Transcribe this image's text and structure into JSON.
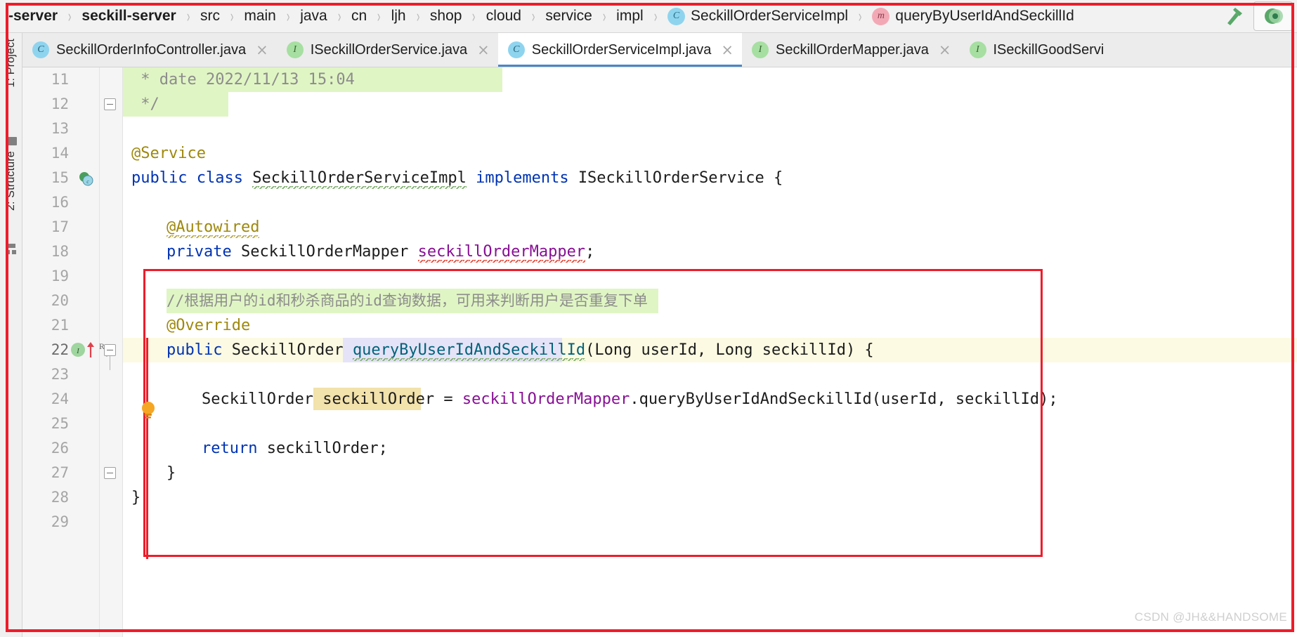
{
  "breadcrumb": {
    "items": [
      {
        "label": "-server",
        "bold": true,
        "icon": null
      },
      {
        "label": "seckill-server",
        "bold": true,
        "icon": null
      },
      {
        "label": "src",
        "bold": false,
        "icon": null
      },
      {
        "label": "main",
        "bold": false,
        "icon": null
      },
      {
        "label": "java",
        "bold": false,
        "icon": null
      },
      {
        "label": "cn",
        "bold": false,
        "icon": null
      },
      {
        "label": "ljh",
        "bold": false,
        "icon": null
      },
      {
        "label": "shop",
        "bold": false,
        "icon": null
      },
      {
        "label": "cloud",
        "bold": false,
        "icon": null
      },
      {
        "label": "service",
        "bold": false,
        "icon": null
      },
      {
        "label": "impl",
        "bold": false,
        "icon": null
      },
      {
        "label": "SeckillOrderServiceImpl",
        "bold": false,
        "icon": "class-icon",
        "icon_letter": "C"
      },
      {
        "label": "queryByUserIdAndSeckillId",
        "bold": false,
        "icon": "method-icon",
        "icon_letter": "m"
      }
    ],
    "separator": "›",
    "actions": {
      "build_label": "build-hammer-icon",
      "run_label": "run-icon"
    }
  },
  "tabs": [
    {
      "label": "SeckillOrderInfoController.java",
      "icon": "class-icon",
      "icon_letter": "C",
      "kind": "class",
      "active": false,
      "close": "×"
    },
    {
      "label": "ISeckillOrderService.java",
      "icon": "interface-icon",
      "icon_letter": "I",
      "kind": "interface",
      "active": false,
      "close": "×"
    },
    {
      "label": "SeckillOrderServiceImpl.java",
      "icon": "class-icon",
      "icon_letter": "C",
      "kind": "class",
      "active": true,
      "close": "×"
    },
    {
      "label": "SeckillOrderMapper.java",
      "icon": "interface-icon",
      "icon_letter": "I",
      "kind": "interface",
      "active": false,
      "close": "×"
    },
    {
      "label": "ISeckillGoodServi",
      "icon": "interface-icon",
      "icon_letter": "I",
      "kind": "interface",
      "active": false,
      "close": ""
    }
  ],
  "tool_strip": {
    "project_label": "1: Project",
    "structure_label": "2: Structure"
  },
  "editor": {
    "first_line": 11,
    "lines": [
      {
        "n": 11,
        "text": " * date 2022/11/13 15:04"
      },
      {
        "n": 12,
        "text": " */"
      },
      {
        "n": 13,
        "text": ""
      },
      {
        "n": 14,
        "text": "@Service"
      },
      {
        "n": 15,
        "text": "public class SeckillOrderServiceImpl implements ISeckillOrderService {"
      },
      {
        "n": 16,
        "text": ""
      },
      {
        "n": 17,
        "text": "    @Autowired"
      },
      {
        "n": 18,
        "text": "    private SeckillOrderMapper seckillOrderMapper;"
      },
      {
        "n": 19,
        "text": ""
      },
      {
        "n": 20,
        "text": "    //根据用户的id和秒杀商品的id查询数据，可用来判断用户是否重复下单"
      },
      {
        "n": 21,
        "text": "    @Override"
      },
      {
        "n": 22,
        "text": "    public SeckillOrder queryByUserIdAndSeckillId(Long userId, Long seckillId) {"
      },
      {
        "n": 23,
        "text": ""
      },
      {
        "n": 24,
        "text": "        SeckillOrder seckillOrder = seckillOrderMapper.queryByUserIdAndSeckillId(userId, seckillId);"
      },
      {
        "n": 25,
        "text": ""
      },
      {
        "n": 26,
        "text": "        return seckillOrder;"
      },
      {
        "n": 27,
        "text": "    }"
      },
      {
        "n": 28,
        "text": "}"
      },
      {
        "n": 29,
        "text": ""
      }
    ],
    "tokens": {
      "l11_comment": " * date 2022/11/13 15:04",
      "l12_comment": " */",
      "l14_annotation": "@Service",
      "l15_public": "public",
      "l15_class": "class",
      "l15_name": "SeckillOrderServiceImpl",
      "l15_implements": "implements",
      "l15_iface": "ISeckillOrderService {",
      "l17_annotation": "@Autowired",
      "l18_private": "private",
      "l18_type": "SeckillOrderMapper",
      "l18_field": "seckillOrderMapper",
      "l18_semi": ";",
      "l20_comment": "//根据用户的id和秒杀商品的id查询数据，可用来判断用户是否重复下单",
      "l21_annotation": "@Override",
      "l22_public": "public",
      "l22_type": "SeckillOrder",
      "l22_method": "queryByUserIdAndSeckillId",
      "l22_params": "(Long userId, Long seckillId) {",
      "l24_type": "SeckillOrder",
      "l24_var": "seckillOrder",
      "l24_eq": " = ",
      "l24_field": "seckillOrderMapper",
      "l24_call": ".queryByUserIdAndSeckillId(userId, seckillId);",
      "l26_return": "return",
      "l26_var": " seckillOrder;",
      "l27_brace": "}",
      "l28_brace": "}"
    },
    "gutter": {
      "implementing_badge": "implementing-method-icon",
      "override_arrow": "overriding-method-icon",
      "recorder_badge": "R",
      "intention_bulb": "intention-bulb-icon"
    }
  },
  "watermark": "CSDN @JH&&HANDSOME",
  "colors": {
    "keyword": "#0033b3",
    "annotation": "#9e880d",
    "comment": "#8c8c8c",
    "field": "#871094",
    "method_decl": "#00627a",
    "caret_red": "#ee1c2a",
    "tab_active_underline": "#4a86c8",
    "comment_highlight": "#e0f5c4",
    "current_line": "#fcfae2",
    "identifier_highlight": "#e5e3f7",
    "usage_highlight": "#f2e2ab"
  }
}
